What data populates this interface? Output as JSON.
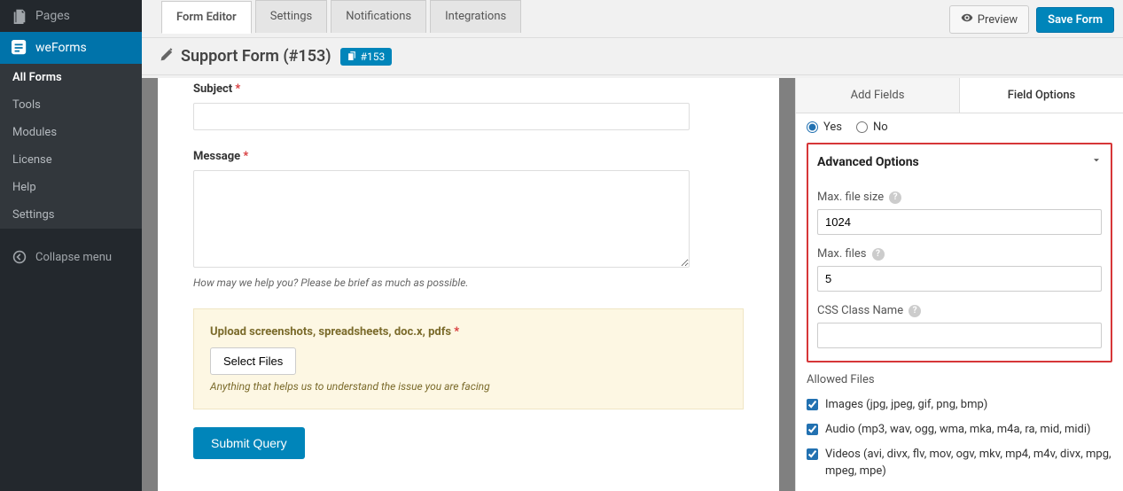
{
  "sidebar": {
    "pages": "Pages",
    "weforms": "weForms",
    "submenu": [
      "All Forms",
      "Tools",
      "Modules",
      "License",
      "Help",
      "Settings"
    ],
    "collapse": "Collapse menu"
  },
  "tabs": [
    "Form Editor",
    "Settings",
    "Notifications",
    "Integrations"
  ],
  "actions": {
    "preview": "Preview",
    "save": "Save Form"
  },
  "title": {
    "name": "Support Form (#153)",
    "badge": "#153"
  },
  "form": {
    "subject": {
      "label": "Subject"
    },
    "message": {
      "label": "Message",
      "help": "How may we help you? Please be brief as much as possible."
    },
    "upload": {
      "label": "Upload screenshots, spreadsheets, doc.x, pdfs",
      "button": "Select Files",
      "help": "Anything that helps us to understand the issue you are facing"
    },
    "submit": "Submit Query"
  },
  "panel": {
    "tabs": {
      "add": "Add Fields",
      "opts": "Field Options"
    },
    "yes": "Yes",
    "no": "No",
    "advanced": "Advanced Options",
    "maxsize": {
      "label": "Max. file size",
      "value": "1024"
    },
    "maxfiles": {
      "label": "Max. files",
      "value": "5"
    },
    "cssclass": {
      "label": "CSS Class Name",
      "value": ""
    },
    "allowed": "Allowed Files",
    "files": {
      "images": "Images (jpg, jpeg, gif, png, bmp)",
      "audio": "Audio (mp3, wav, ogg, wma, mka, m4a, ra, mid, midi)",
      "videos": "Videos (avi, divx, flv, mov, ogv, mkv, mp4, m4v, divx, mpg, mpeg, mpe)"
    }
  }
}
